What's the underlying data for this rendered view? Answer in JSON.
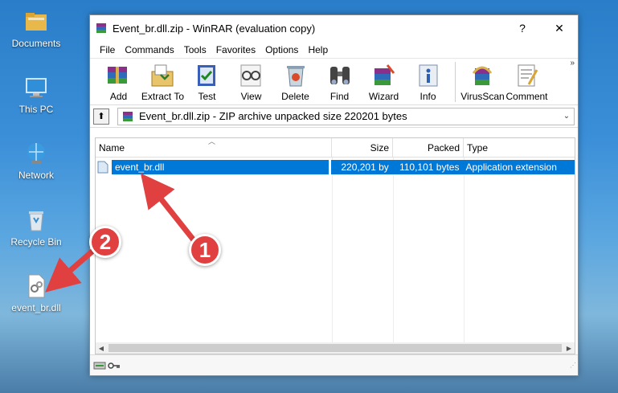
{
  "desktop": {
    "icons": [
      {
        "label": "Documents",
        "icon": "folder-icon"
      },
      {
        "label": "This PC",
        "icon": "computer-icon"
      },
      {
        "label": "Network",
        "icon": "network-icon"
      },
      {
        "label": "Recycle Bin",
        "icon": "recycle-bin-icon"
      },
      {
        "label": "event_br.dll",
        "icon": "dll-file-icon"
      }
    ]
  },
  "window": {
    "title": "Event_br.dll.zip - WinRAR (evaluation copy)",
    "help_label": "?",
    "close_label": "✕",
    "menu": [
      "File",
      "Commands",
      "Tools",
      "Favorites",
      "Options",
      "Help"
    ],
    "toolbar": [
      {
        "label": "Add",
        "icon": "add-archive-icon"
      },
      {
        "label": "Extract To",
        "icon": "extract-to-icon"
      },
      {
        "label": "Test",
        "icon": "test-icon"
      },
      {
        "label": "View",
        "icon": "view-icon"
      },
      {
        "label": "Delete",
        "icon": "delete-icon"
      },
      {
        "label": "Find",
        "icon": "find-binoculars-icon"
      },
      {
        "label": "Wizard",
        "icon": "wizard-icon"
      },
      {
        "label": "Info",
        "icon": "info-icon"
      },
      {
        "label": "VirusScan",
        "icon": "virus-scan-icon"
      },
      {
        "label": "Comment",
        "icon": "comment-icon"
      }
    ],
    "more_label": "»",
    "address": "Event_br.dll.zip - ZIP archive unpacked size 220201 bytes",
    "columns": {
      "name": "Name",
      "size": "Size",
      "packed": "Packed",
      "type": "Type"
    },
    "files": [
      {
        "name": "event_br.dll",
        "size": "220,201 by",
        "packed": "110,101 bytes",
        "type": "Application extension"
      }
    ]
  },
  "annotations": {
    "badge1": "1",
    "badge2": "2",
    "color": "#e04040"
  }
}
